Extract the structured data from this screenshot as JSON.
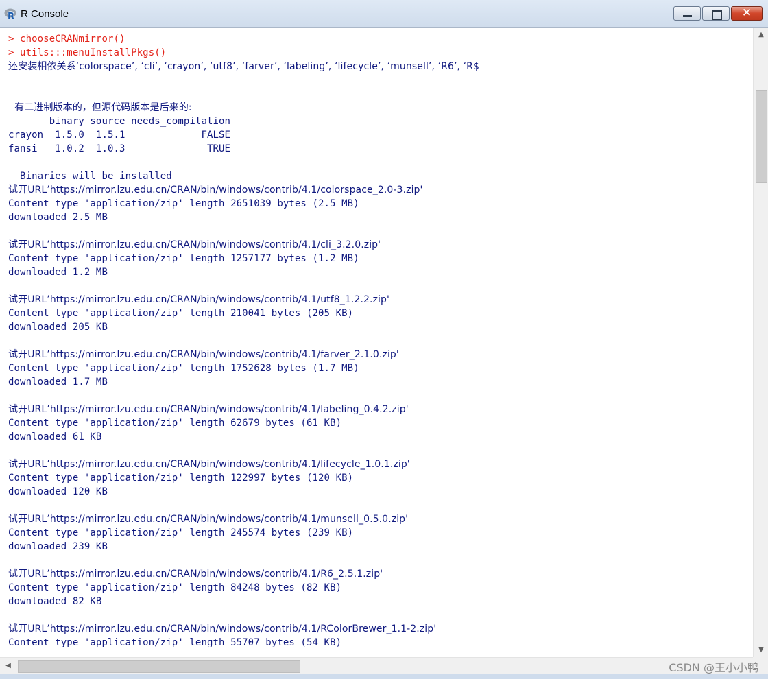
{
  "window": {
    "title": "R Console",
    "app_icon_letter": "R",
    "close_glyph": "✕"
  },
  "console": {
    "lines": [
      {
        "text": "> chooseCRANmirror()",
        "kind": "cmd"
      },
      {
        "text": "> utils:::menuInstallPkgs()",
        "kind": "cmd"
      },
      {
        "text": "还安装相依关系‘colorspace’, ‘cli’, ‘crayon’, ‘utf8’, ‘farver’, ‘labeling’, ‘lifecycle’, ‘munsell’, ‘R6’, ‘R$",
        "kind": "cn"
      },
      {
        "text": "",
        "kind": "out"
      },
      {
        "text": "",
        "kind": "out"
      },
      {
        "text": "  有二进制版本的，但源代码版本是后来的:",
        "kind": "cn"
      },
      {
        "text": "       binary source needs_compilation",
        "kind": "out"
      },
      {
        "text": "crayon  1.5.0  1.5.1             FALSE",
        "kind": "out"
      },
      {
        "text": "fansi   1.0.2  1.0.3              TRUE",
        "kind": "out"
      },
      {
        "text": "",
        "kind": "out"
      },
      {
        "text": "  Binaries will be installed",
        "kind": "out"
      },
      {
        "text": "试开URL’https://mirror.lzu.edu.cn/CRAN/bin/windows/contrib/4.1/colorspace_2.0-3.zip'",
        "kind": "cn"
      },
      {
        "text": "Content type 'application/zip' length 2651039 bytes (2.5 MB)",
        "kind": "out"
      },
      {
        "text": "downloaded 2.5 MB",
        "kind": "out"
      },
      {
        "text": "",
        "kind": "out"
      },
      {
        "text": "试开URL’https://mirror.lzu.edu.cn/CRAN/bin/windows/contrib/4.1/cli_3.2.0.zip'",
        "kind": "cn"
      },
      {
        "text": "Content type 'application/zip' length 1257177 bytes (1.2 MB)",
        "kind": "out"
      },
      {
        "text": "downloaded 1.2 MB",
        "kind": "out"
      },
      {
        "text": "",
        "kind": "out"
      },
      {
        "text": "试开URL’https://mirror.lzu.edu.cn/CRAN/bin/windows/contrib/4.1/utf8_1.2.2.zip'",
        "kind": "cn"
      },
      {
        "text": "Content type 'application/zip' length 210041 bytes (205 KB)",
        "kind": "out"
      },
      {
        "text": "downloaded 205 KB",
        "kind": "out"
      },
      {
        "text": "",
        "kind": "out"
      },
      {
        "text": "试开URL’https://mirror.lzu.edu.cn/CRAN/bin/windows/contrib/4.1/farver_2.1.0.zip'",
        "kind": "cn"
      },
      {
        "text": "Content type 'application/zip' length 1752628 bytes (1.7 MB)",
        "kind": "out"
      },
      {
        "text": "downloaded 1.7 MB",
        "kind": "out"
      },
      {
        "text": "",
        "kind": "out"
      },
      {
        "text": "试开URL’https://mirror.lzu.edu.cn/CRAN/bin/windows/contrib/4.1/labeling_0.4.2.zip'",
        "kind": "cn"
      },
      {
        "text": "Content type 'application/zip' length 62679 bytes (61 KB)",
        "kind": "out"
      },
      {
        "text": "downloaded 61 KB",
        "kind": "out"
      },
      {
        "text": "",
        "kind": "out"
      },
      {
        "text": "试开URL’https://mirror.lzu.edu.cn/CRAN/bin/windows/contrib/4.1/lifecycle_1.0.1.zip'",
        "kind": "cn"
      },
      {
        "text": "Content type 'application/zip' length 122997 bytes (120 KB)",
        "kind": "out"
      },
      {
        "text": "downloaded 120 KB",
        "kind": "out"
      },
      {
        "text": "",
        "kind": "out"
      },
      {
        "text": "试开URL’https://mirror.lzu.edu.cn/CRAN/bin/windows/contrib/4.1/munsell_0.5.0.zip'",
        "kind": "cn"
      },
      {
        "text": "Content type 'application/zip' length 245574 bytes (239 KB)",
        "kind": "out"
      },
      {
        "text": "downloaded 239 KB",
        "kind": "out"
      },
      {
        "text": "",
        "kind": "out"
      },
      {
        "text": "试开URL’https://mirror.lzu.edu.cn/CRAN/bin/windows/contrib/4.1/R6_2.5.1.zip'",
        "kind": "cn"
      },
      {
        "text": "Content type 'application/zip' length 84248 bytes (82 KB)",
        "kind": "out"
      },
      {
        "text": "downloaded 82 KB",
        "kind": "out"
      },
      {
        "text": "",
        "kind": "out"
      },
      {
        "text": "试开URL’https://mirror.lzu.edu.cn/CRAN/bin/windows/contrib/4.1/RColorBrewer_1.1-2.zip'",
        "kind": "cn"
      },
      {
        "text": "Content type 'application/zip' length 55707 bytes (54 KB)",
        "kind": "out"
      }
    ]
  },
  "scrollbars": {
    "up_arrow": "▲",
    "down_arrow": "▼",
    "left_arrow": "◀"
  },
  "watermark": "CSDN @王小小鸭",
  "colors": {
    "command": "#e3241b",
    "output": "#111a80",
    "close_button": "#d2472b"
  }
}
